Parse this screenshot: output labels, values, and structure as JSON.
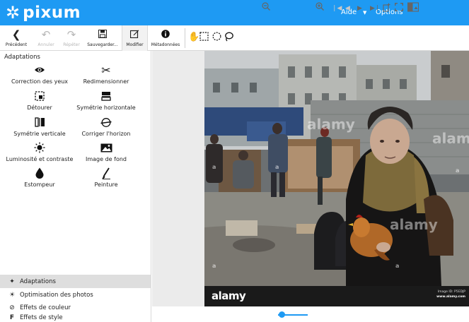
{
  "header": {
    "logo_text": "pixum",
    "help_label": "Aide",
    "options_label": "Options",
    "colors": {
      "brand": "#1e9af3"
    }
  },
  "toolbar": {
    "back_label": "Précédent",
    "undo_label": "Annuler",
    "redo_label": "Répéter",
    "save_label": "Sauvegarder...",
    "edit_label": "Modifier",
    "metadata_label": "Métadonnées"
  },
  "left_panel": {
    "section_title": "Adaptations",
    "tools": [
      {
        "label": "Correction des yeux",
        "icon": "eye-icon"
      },
      {
        "label": "Redimensionner",
        "icon": "scissors-icon"
      },
      {
        "label": "Détourer",
        "icon": "crop-icon"
      },
      {
        "label": "Symétrie horizontale",
        "icon": "flip-horizontal-icon"
      },
      {
        "label": "Symétrie verticale",
        "icon": "flip-vertical-icon"
      },
      {
        "label": "Corriger l'horizon",
        "icon": "horizon-icon"
      },
      {
        "label": "Luminosité et contraste",
        "icon": "brightness-icon"
      },
      {
        "label": "Image de fond",
        "icon": "image-background-icon"
      },
      {
        "label": "Estompeur",
        "icon": "drop-icon"
      },
      {
        "label": "Peinture",
        "icon": "brush-icon"
      }
    ],
    "categories": [
      {
        "label": "Adaptations",
        "icon": "adaptations-icon",
        "selected": true
      },
      {
        "label": "Optimisation des photos",
        "icon": "sun-icon",
        "selected": false
      },
      {
        "label": "Effets de couleur",
        "icon": "color-effects-icon",
        "selected": false
      },
      {
        "label": "Effets de style",
        "icon": "style-effects-icon",
        "selected": false
      }
    ]
  },
  "photo": {
    "watermark": "alamy",
    "footer_logo": "alamy",
    "image_id": "Image ID: P5EDJP",
    "source_url": "www.alamy.com"
  }
}
